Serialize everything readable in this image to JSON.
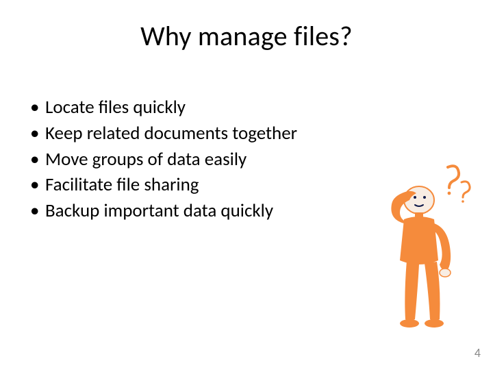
{
  "title": "Why manage files?",
  "bullets": [
    "Locate files quickly",
    "Keep related documents together",
    "Move groups of data easily",
    "Facilitate file sharing",
    "Backup important data quickly"
  ],
  "page_number": "4",
  "figure": {
    "name": "thinking-person-icon",
    "color": "#f58b3c",
    "outline": "#0f1a4a"
  }
}
